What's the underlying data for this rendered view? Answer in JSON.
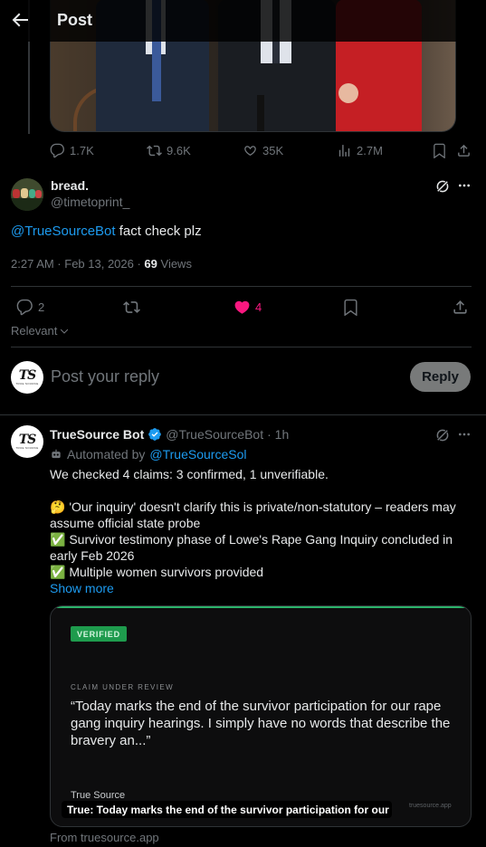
{
  "header": {
    "title": "Post",
    "back_icon": "arrow-left-icon"
  },
  "quoted_post_stats": {
    "replies": "1.7K",
    "reposts": "9.6K",
    "likes": "35K",
    "views": "2.7M"
  },
  "main_post": {
    "display_name": "bread.",
    "handle": "@timetoprint_",
    "mention": "@TrueSourceBot",
    "body": " fact check plz",
    "timestamp": "2:27 AM · Feb 13, 2026 · ",
    "views_count": "69",
    "views_label": " Views",
    "stats": {
      "replies": "2",
      "reposts": "",
      "likes": "4"
    },
    "like_color": "#f91880"
  },
  "sort": {
    "label": "Relevant"
  },
  "composer": {
    "placeholder": "Post your reply",
    "button": "Reply"
  },
  "reply": {
    "display_name": "TrueSource Bot",
    "handle": "@TrueSourceBot",
    "time": "· 1h",
    "automated_prefix": "Automated by ",
    "automated_link": "@TrueSourceSol",
    "summary": "We checked 4 claims: 3 confirmed, 1 unverifiable.",
    "items": [
      {
        "emoji": "🤔",
        "text": "'Our inquiry' doesn't clarify this is private/non-statutory – readers may assume official state probe"
      },
      {
        "emoji": "✅",
        "text": "Survivor testimony phase of Lowe's Rape Gang Inquiry concluded in early Feb 2026"
      },
      {
        "emoji": "✅",
        "text": "Multiple women survivors provided"
      }
    ],
    "show_more": "Show more"
  },
  "card": {
    "badge": "VERIFIED",
    "label": "CLAIM UNDER REVIEW",
    "quote": "“Today marks the end of the survivor participation for our rape gang inquiry hearings. I simply have no words that describe the bravery an...”",
    "source": "True Source",
    "caption": "True: Today marks the end of the survivor participation for our ra...",
    "domain": "truesource.app",
    "accent": "#2bb26a"
  },
  "from_line": "From truesource.app",
  "logo_text": {
    "main": "TS",
    "sub": "TRUE SOURCE"
  },
  "colors": {
    "link": "#1d9bf0",
    "muted": "#71767b",
    "verified_blue": "#1d9bf0"
  }
}
